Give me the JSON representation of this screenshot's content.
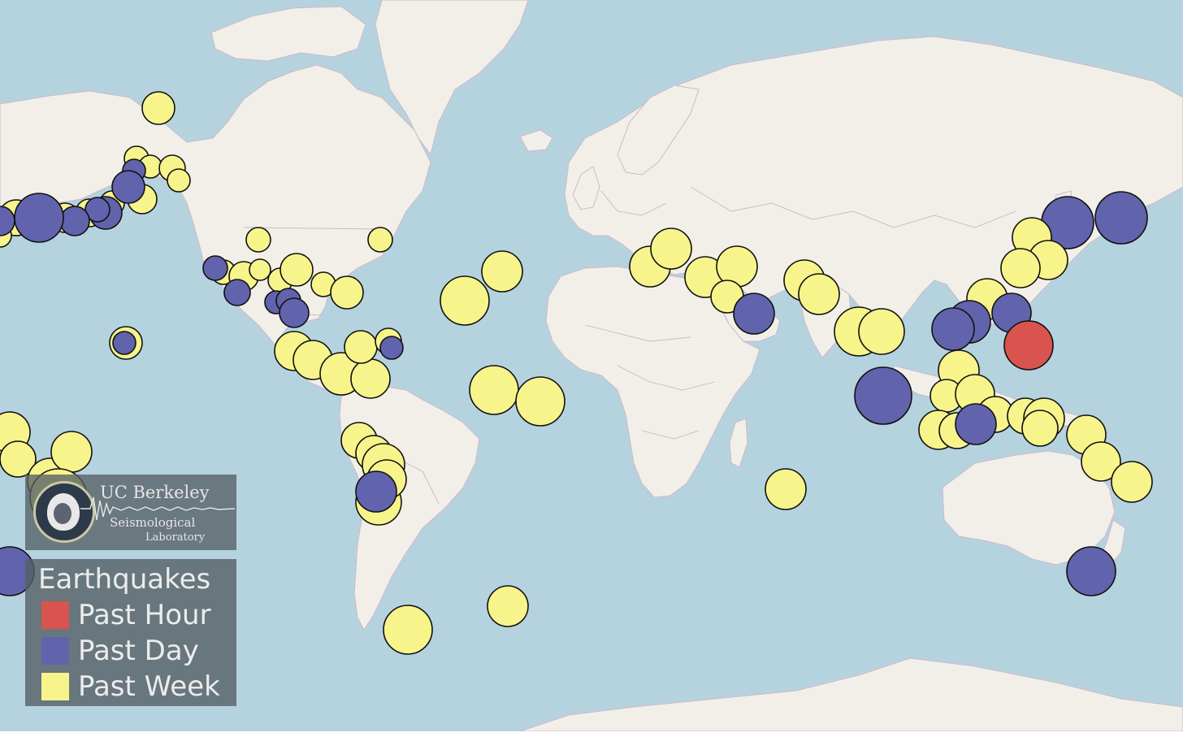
{
  "colors": {
    "ocean": "#b5d3df",
    "land": "#f2efe9",
    "past_hour": "#d9534f",
    "past_day": "#6163ad",
    "past_week": "#f7f48c"
  },
  "logo": {
    "title": "UC Berkeley",
    "subtitle_line1": "Seismological",
    "subtitle_line2": "Laboratory"
  },
  "legend": {
    "title": "Earthquakes",
    "items": [
      {
        "label": "Past Hour",
        "color": "#d9534f"
      },
      {
        "label": "Past Day",
        "color": "#6163ad"
      },
      {
        "label": "Past Week",
        "color": "#f7f48c"
      }
    ]
  }
}
